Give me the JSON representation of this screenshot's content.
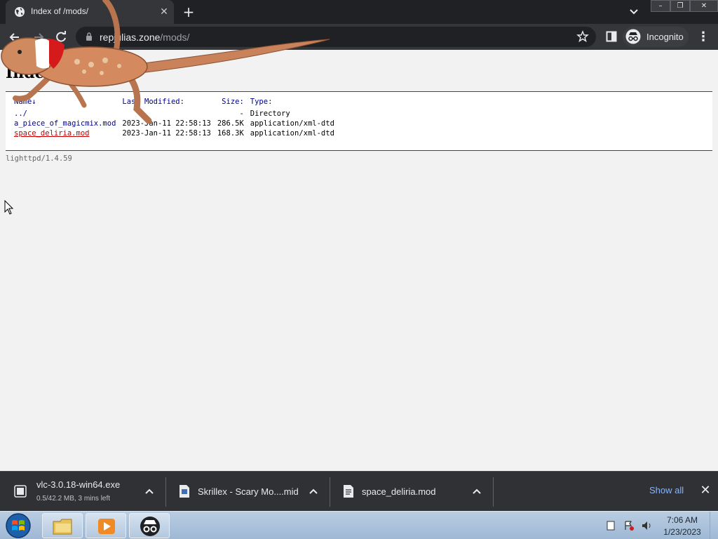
{
  "browser": {
    "tab_title": "Index of /mods/",
    "tab_close": "✕",
    "new_tab": "+",
    "url_host": "repjulias.zone",
    "url_path": "/mods/",
    "incognito_label": "Incognito",
    "window_controls": {
      "minimize": "–",
      "maximize": "❐",
      "close": "✕"
    }
  },
  "page": {
    "title": "Index of /mods/",
    "columns": {
      "name": "Name↓",
      "modified": "Last Modified:",
      "size": "Size:",
      "type": "Type:"
    },
    "rows": [
      {
        "name": "../",
        "modified": "",
        "size": "-",
        "type": "Directory",
        "visited": false
      },
      {
        "name": "a_piece_of_magicmix.mod",
        "modified": "2023-Jan-11 22:58:13",
        "size": "286.5K",
        "type": "application/xml-dtd",
        "visited": false
      },
      {
        "name": "space_deliria.mod",
        "modified": "2023-Jan-11 22:58:13",
        "size": "168.3K",
        "type": "application/xml-dtd",
        "visited": true
      }
    ],
    "footer": "lighttpd/1.4.59"
  },
  "downloads": {
    "items": [
      {
        "name": "vlc-3.0.18-win64.exe",
        "status": "0.5/42.2 MB, 3 mins left"
      },
      {
        "name": "Skrillex - Scary Mo....mid",
        "status": ""
      },
      {
        "name": "space_deliria.mod",
        "status": ""
      }
    ],
    "show_all": "Show all",
    "close": "✕"
  },
  "taskbar": {
    "time": "7:06 AM",
    "date": "1/23/2023"
  },
  "colors": {
    "chrome_dark": "#202124",
    "toolbar": "#35363a",
    "link": "#00008b",
    "visited_link": "#c00000",
    "accent_blue": "#8ab4f8"
  }
}
